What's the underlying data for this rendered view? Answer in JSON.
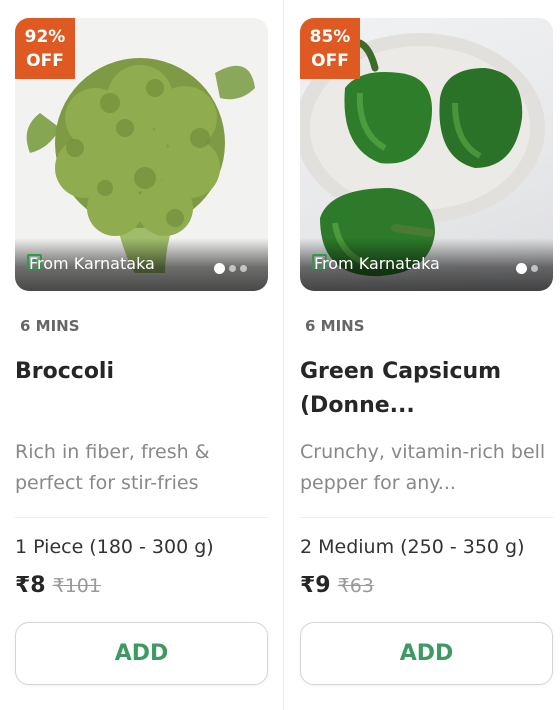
{
  "products": [
    {
      "discount_line1": "92%",
      "discount_line2": "OFF",
      "origin": "From Karnataka",
      "delivery_time": "6 MINS",
      "name": "Broccoli",
      "description": "Rich in fiber, fresh & perfect for stir-fries",
      "quantity": "1 Piece (180 - 300 g)",
      "price": "₹8",
      "mrp": "₹101",
      "add_label": "ADD",
      "image_icon": "broccoli-image"
    },
    {
      "discount_line1": "85%",
      "discount_line2": "OFF",
      "origin": "From Karnataka",
      "delivery_time": "6 MINS",
      "name": "Green Capsicum (Donne...",
      "description": "Crunchy, vitamin-rich bell pepper for any...",
      "quantity": "2 Medium (250 - 350 g)",
      "price": "₹9",
      "mrp": "₹63",
      "add_label": "ADD",
      "image_icon": "capsicum-image"
    }
  ],
  "colors": {
    "discount_badge": "#df5a23",
    "add_text": "#3e9a62",
    "veg_icon": "#2e9b4a"
  }
}
